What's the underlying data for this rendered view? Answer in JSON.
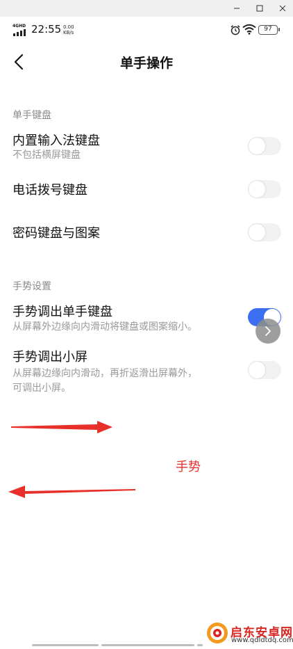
{
  "window": {
    "minimize_icon": "minimize-icon",
    "maximize_icon": "maximize-icon",
    "close_icon": "close-icon"
  },
  "status_bar": {
    "network": "4GHD",
    "time": "22:55",
    "speed_value": "0.00",
    "speed_unit": "KB/s",
    "battery": "97"
  },
  "header": {
    "title": "单手操作"
  },
  "sections": [
    {
      "header": "单手键盘",
      "items": [
        {
          "title": "内置输入法键盘",
          "subtitle": "不包括横屏键盘",
          "enabled": false
        },
        {
          "title": "电话拨号键盘",
          "enabled": false
        },
        {
          "title": "密码键盘与图案",
          "enabled": false
        }
      ]
    },
    {
      "header": "手势设置",
      "items": [
        {
          "title": "手势调出单手键盘",
          "subtitle": "从屏幕外边缘向内滑动将键盘或图案缩小。",
          "enabled": true
        },
        {
          "title": "手势调出小屏",
          "subtitle_line1": "从屏幕边缘向内滑动，再折返滑出屏幕外，",
          "subtitle_line2": "可调出小屏。",
          "enabled": false
        }
      ]
    }
  ],
  "annotation": {
    "text": "手势",
    "color": "#e8302b"
  },
  "watermark": {
    "name": "启东安卓网",
    "url": "www.qdldtdq.com"
  },
  "colors": {
    "accent": "#3a6ff0",
    "toggle_off": "#f1f1f1",
    "annotation_red": "#e8302b"
  }
}
